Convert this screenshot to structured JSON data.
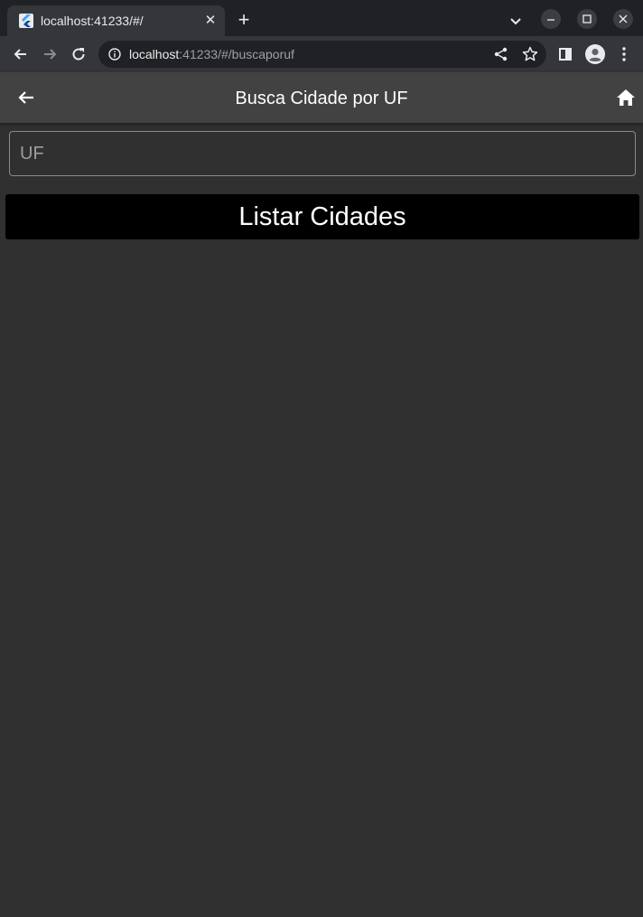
{
  "browser": {
    "tab_title": "localhost:41233/#/",
    "tab_close": "✕",
    "new_tab": "+",
    "url_host": "localhost",
    "url_rest": ":41233/#/buscaporuf",
    "icons": [
      "favicon-icon",
      "tab-search-icon",
      "minimize-icon",
      "maximize-icon",
      "close-window-icon",
      "back-icon",
      "forward-icon",
      "reload-icon",
      "site-info-icon",
      "share-icon",
      "bookmark-star-icon",
      "side-panel-icon",
      "profile-icon",
      "menu-kebab-icon"
    ]
  },
  "appbar": {
    "title": "Busca Cidade por UF",
    "icons": [
      "arrow-back-icon",
      "home-icon"
    ]
  },
  "form": {
    "uf_placeholder": "UF",
    "uf_value": "",
    "button_label": "Listar Cidades"
  },
  "colors": {
    "background": "#303030",
    "appbar": "#424242",
    "button": "#000000",
    "text": "#ffffff",
    "placeholder": "#9e9e9e"
  }
}
